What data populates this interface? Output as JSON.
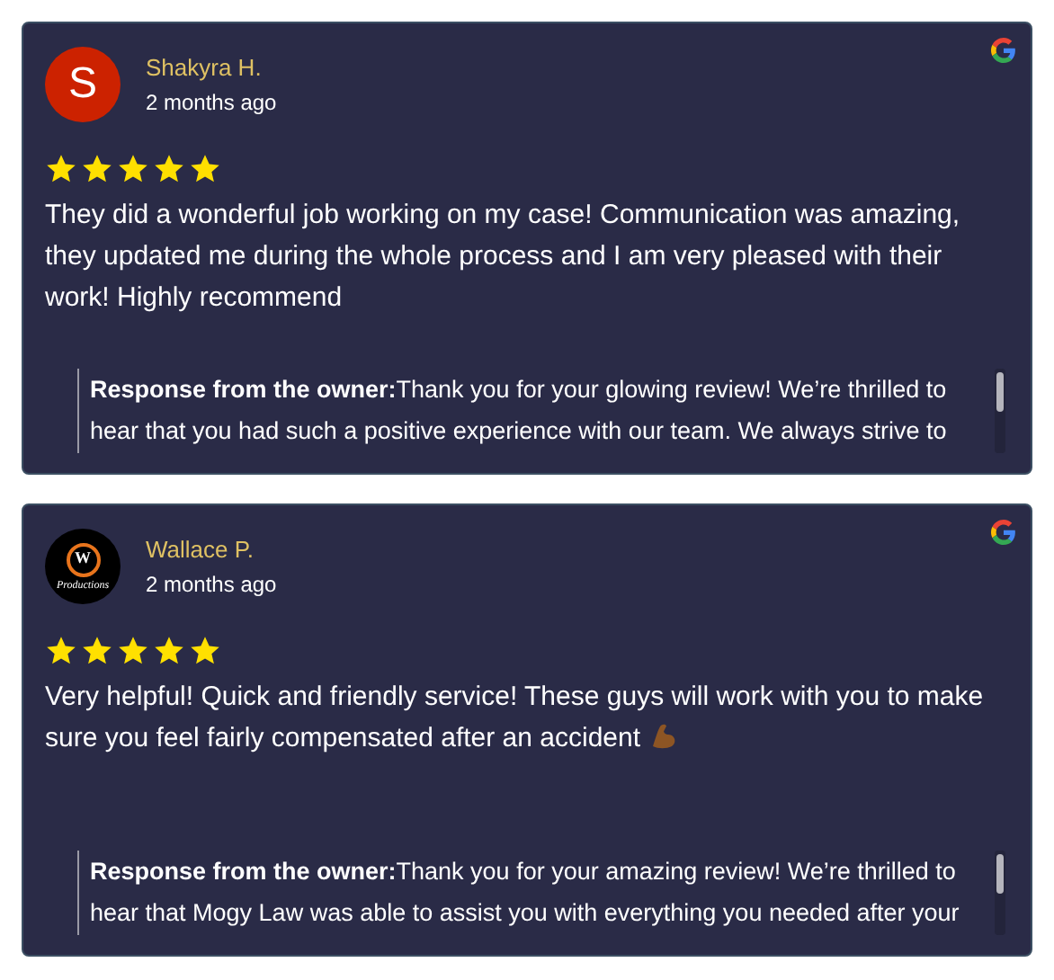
{
  "reviews": [
    {
      "author": "Shakyra H.",
      "time": "2 months ago",
      "avatar": {
        "kind": "letter",
        "letter": "S",
        "color": "#cc2200"
      },
      "stars": 5,
      "text": "They did a wonderful job working on my case! Communication was amazing, they updated me during the whole process and I am very pleased with their work! Highly recommend",
      "emoji": false,
      "response": "**Response from the owner:**Thank you for your glowing review! We’re thrilled to hear that you had such a positive experience with our team. We always strive to"
    },
    {
      "author": "Wallace P.",
      "time": "2 months ago",
      "avatar": {
        "kind": "logo",
        "letter": "W",
        "caption": "Productions"
      },
      "stars": 5,
      "text": "Very helpful! Quick and friendly service! These guys will work with you to make sure you feel fairly compensated after an accident",
      "emoji": true,
      "response": "**Response from the owner:**Thank you for your amazing review! We’re thrilled to hear that Mogy Law was able to assist you with everything you needed after your"
    }
  ]
}
